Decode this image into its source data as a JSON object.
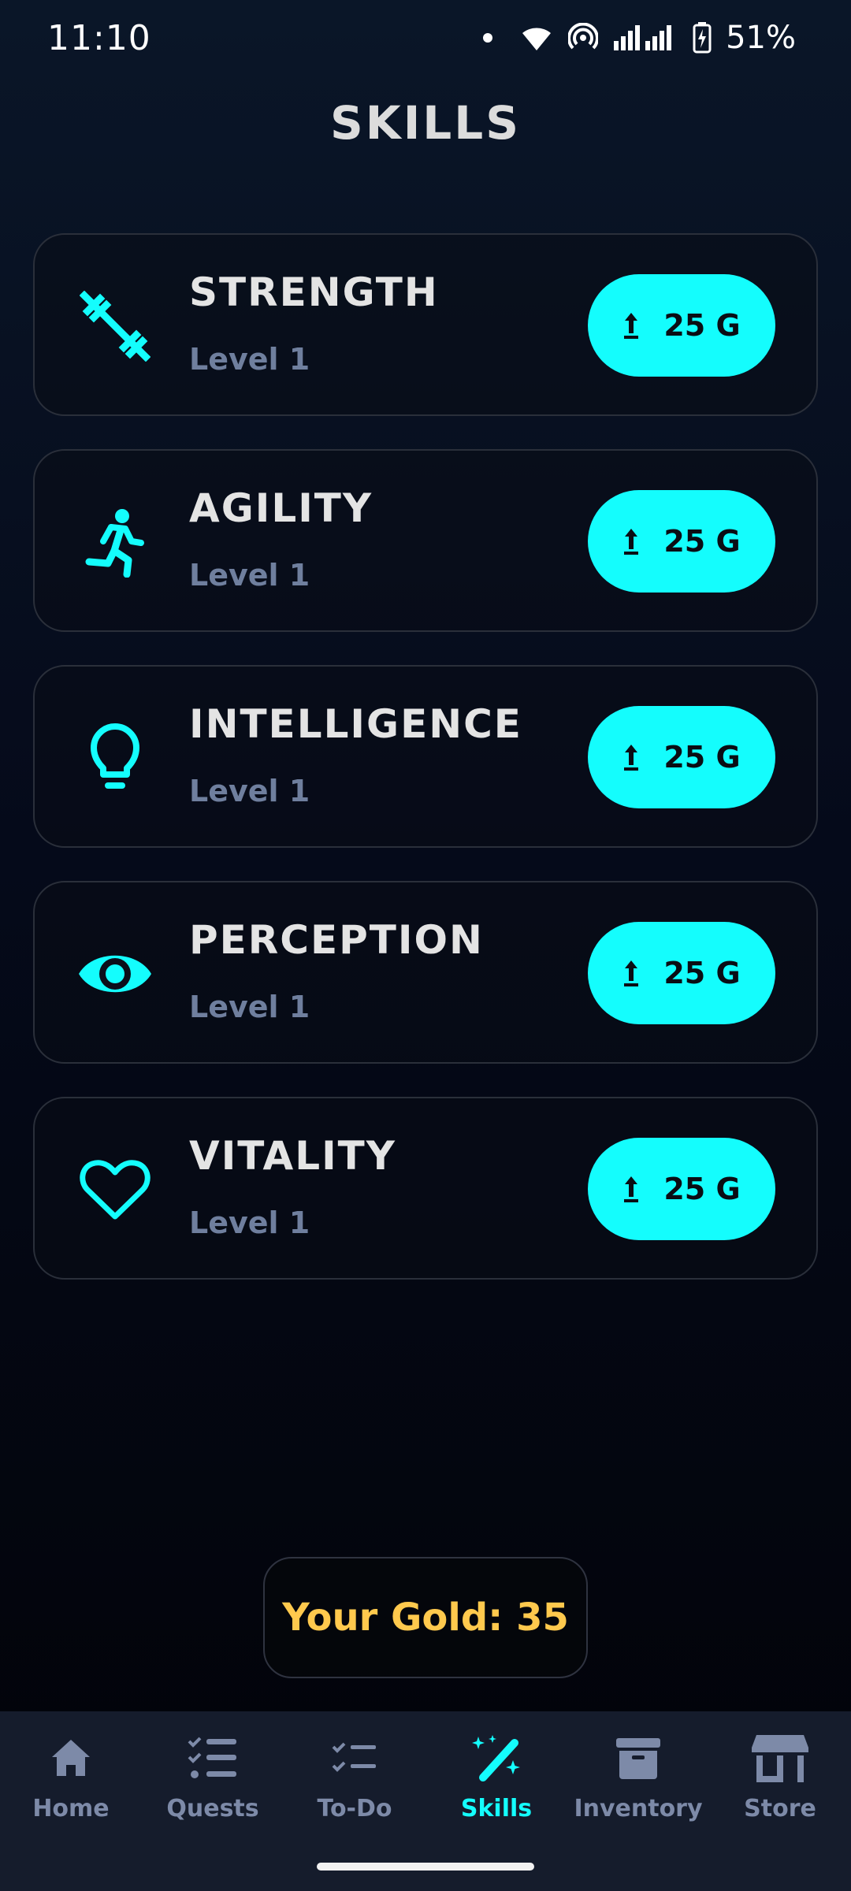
{
  "status_bar": {
    "time": "11:10",
    "battery": "51%"
  },
  "page": {
    "title": "SKILLS"
  },
  "skills": [
    {
      "name": "STRENGTH",
      "level": "Level 1",
      "cost": "25 G",
      "icon": "dumbbell-icon"
    },
    {
      "name": "AGILITY",
      "level": "Level 1",
      "cost": "25 G",
      "icon": "running-icon"
    },
    {
      "name": "INTELLIGENCE",
      "level": "Level 1",
      "cost": "25 G",
      "icon": "lightbulb-icon"
    },
    {
      "name": "PERCEPTION",
      "level": "Level 1",
      "cost": "25 G",
      "icon": "eye-icon"
    },
    {
      "name": "VITALITY",
      "level": "Level 1",
      "cost": "25 G",
      "icon": "heart-icon"
    }
  ],
  "gold": {
    "label": "Your Gold: 35"
  },
  "nav": {
    "items": [
      {
        "label": "Home",
        "icon": "home-icon",
        "active": false
      },
      {
        "label": "Quests",
        "icon": "checklist-icon",
        "active": false
      },
      {
        "label": "To-Do",
        "icon": "todo-icon",
        "active": false
      },
      {
        "label": "Skills",
        "icon": "magic-wand-icon",
        "active": true
      },
      {
        "label": "Inventory",
        "icon": "archive-box-icon",
        "active": false
      },
      {
        "label": "Store",
        "icon": "store-icon",
        "active": false
      }
    ]
  },
  "colors": {
    "accent": "#14fdfd",
    "gold": "#ffc94d",
    "muted": "#7d8aa8",
    "nav_bg": "#151c2c"
  }
}
